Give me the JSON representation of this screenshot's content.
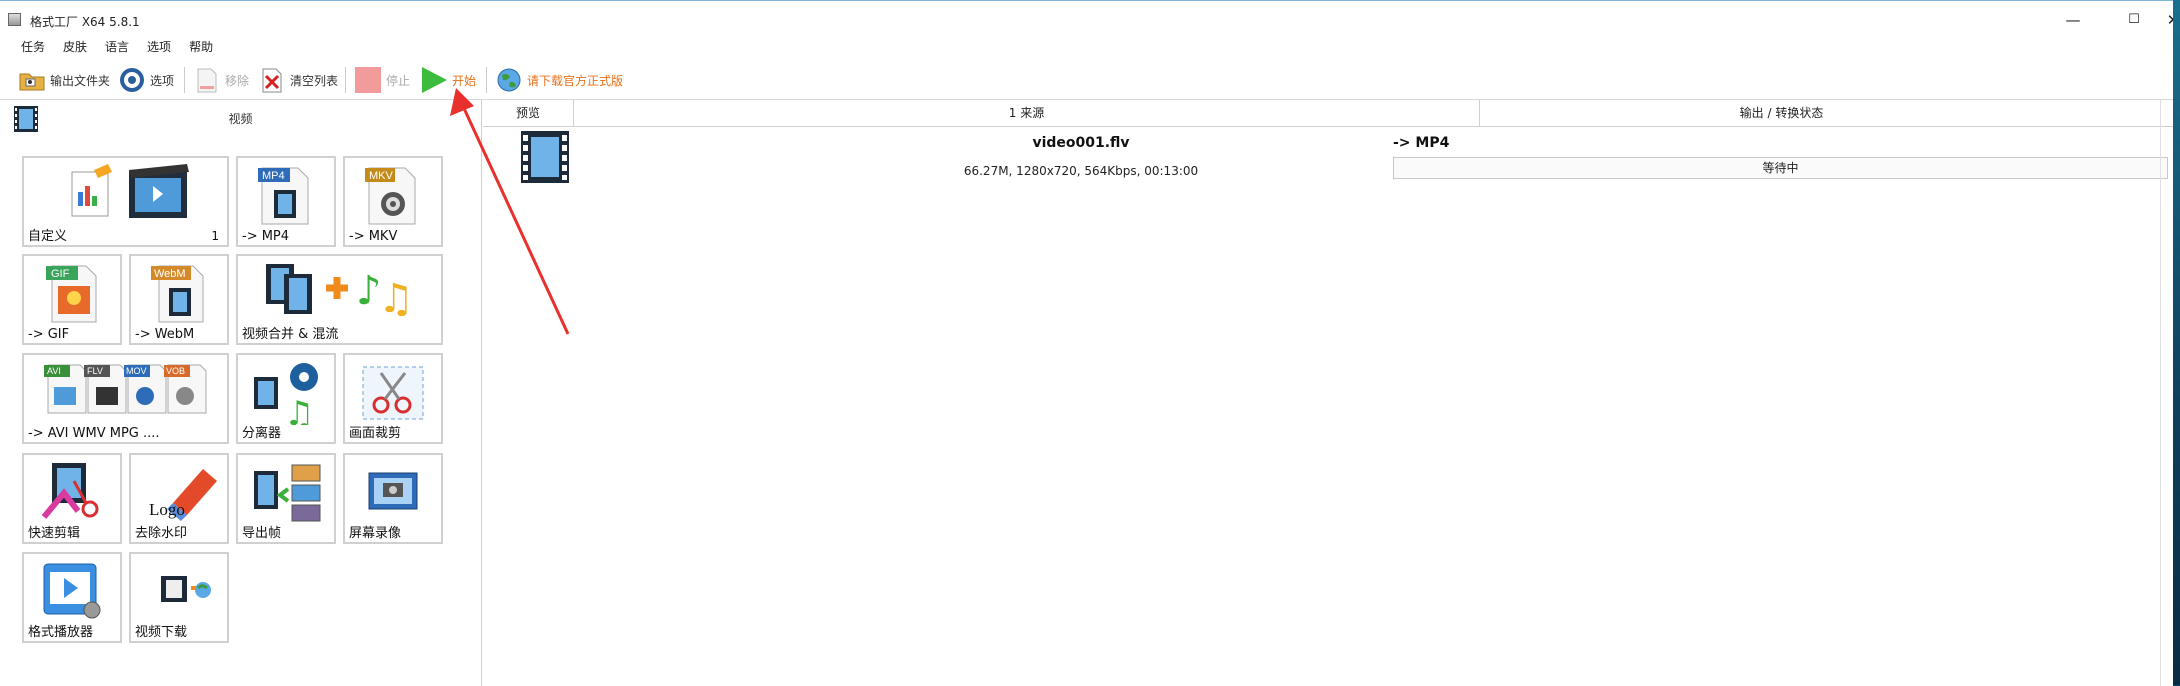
{
  "window": {
    "title": "格式工厂 X64 5.8.1",
    "controls": {
      "minimize": "—",
      "maximize": "☐",
      "close": "✕"
    }
  },
  "menu": [
    "任务",
    "皮肤",
    "语言",
    "选项",
    "帮助"
  ],
  "toolbar": {
    "output_folder": "输出文件夹",
    "options": "选项",
    "remove": "移除",
    "clear_list": "清空列表",
    "stop": "停止",
    "start": "开始",
    "download_official": "请下载官方正式版"
  },
  "category": {
    "title": "视频"
  },
  "tiles": {
    "custom": {
      "label": "自定义",
      "count": "1"
    },
    "mp4": {
      "label": "-> MP4",
      "badge": "MP4"
    },
    "mkv": {
      "label": "-> MKV",
      "badge": "MKV"
    },
    "gif": {
      "label": "-> GIF",
      "badge": "GIF"
    },
    "webm": {
      "label": "-> WebM",
      "badge": "WebM"
    },
    "merge": {
      "label": "视频合并 & 混流"
    },
    "multi": {
      "label": "-> AVI WMV MPG ....",
      "badges": [
        "AVI",
        "FLV",
        "MOV",
        "VOB"
      ]
    },
    "splitter": {
      "label": "分离器"
    },
    "crop": {
      "label": "画面裁剪"
    },
    "quick_clip": {
      "label": "快速剪辑"
    },
    "remove_watermark": {
      "label": "去除水印",
      "logo_text": "Logo"
    },
    "export_frames": {
      "label": "导出帧"
    },
    "screen_record": {
      "label": "屏幕录像"
    },
    "player": {
      "label": "格式播放器"
    },
    "video_download": {
      "label": "视频下载"
    }
  },
  "task_list": {
    "columns": [
      "预览",
      "1 来源",
      "输出 / 转换状态"
    ],
    "rows": [
      {
        "file_name": "video001.flv",
        "info": "66.27M, 1280x720, 564Kbps, 00:13:00",
        "output": "-> MP4",
        "status": "等待中"
      }
    ]
  },
  "colors": {
    "accent_orange": "#e8701a",
    "start_green": "#3dbb3d",
    "stop_red": "#f08080",
    "arrow_red": "#e8302c"
  }
}
